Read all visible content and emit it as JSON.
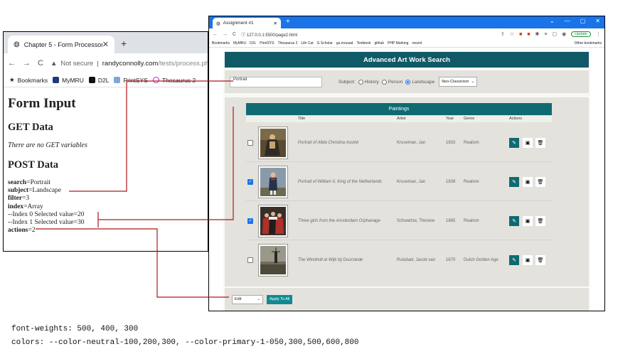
{
  "left_browser": {
    "tab_title": "Chapter 5 - Form Processor",
    "tab_close": "✕",
    "new_tab": "+",
    "address": {
      "not_secure": "Not secure",
      "separator": "|",
      "host": "randyconnolly.com",
      "path": "/tests/process.php"
    },
    "bookmarks": [
      "Bookmarks",
      "MyMRU",
      "D2L",
      "PrintSYS",
      "Thesaurus 2"
    ],
    "content": {
      "heading": "Form Input",
      "get_heading": "GET Data",
      "get_note": "There are no GET variables",
      "post_heading": "POST Data",
      "post_items": [
        {
          "key": "search",
          "value": "=Portrait"
        },
        {
          "key": "subject",
          "value": "=Landscape"
        },
        {
          "key": "filter",
          "value": "=3"
        },
        {
          "key": "index",
          "value": "=Array"
        },
        {
          "key": "",
          "value": "--Index 0 Selected value=20"
        },
        {
          "key": "",
          "value": "--Index 1 Selected value=30"
        },
        {
          "key": "actions",
          "value": "=2"
        }
      ]
    }
  },
  "right_browser": {
    "tab_title": "Assignment #1",
    "tab_close": "✕",
    "new_tab": "+",
    "window_controls": [
      "⌄",
      "—",
      "▢",
      "✕"
    ],
    "url": "127.0.0.1:5500/page2.html",
    "update_label": "Update",
    "bookmarks": [
      "Bookmarks",
      "MyMRU",
      "D2L",
      "PrintSYS",
      "Thesaurus 2",
      "Life Cat",
      "G Scholar",
      "gu.mrusad",
      "Textbook",
      "github",
      "PHP Marking",
      "recent"
    ],
    "other_bookmarks": "Other bookmarks"
  },
  "page": {
    "banner": "Advanced Art Work Search",
    "search_value": "Portrait",
    "subject_label": "Subject:",
    "subjects": [
      {
        "label": "History",
        "checked": false
      },
      {
        "label": "Person",
        "checked": false
      },
      {
        "label": "Landscape",
        "checked": true
      }
    ],
    "genre_selected": "Neo-Classicism",
    "paintings_heading": "Paintings",
    "columns": {
      "title": "Title",
      "artist": "Artist",
      "year": "Year",
      "genre": "Genre",
      "actions": "Actions"
    },
    "rows": [
      {
        "checked": false,
        "title": "Portrait of Alida Christina Assink",
        "artist": "Kruseman, Jan",
        "year": "1833",
        "genre": "Realism",
        "art": "art-1"
      },
      {
        "checked": true,
        "title": "Portrait of William II, King of the Netherlands",
        "artist": "Kruseman, Jan",
        "year": "1839",
        "genre": "Realism",
        "art": "art-2"
      },
      {
        "checked": true,
        "title": "Three girls from the Amsterdam Orphanage",
        "artist": "Schwartze, Therese",
        "year": "1885",
        "genre": "Realism",
        "art": "art-3"
      },
      {
        "checked": false,
        "title": "The Windmill at Wijk bij Duurstede",
        "artist": "Ruisdael, Jacob van",
        "year": "1670",
        "genre": "Dutch Golden Age",
        "art": "art-4"
      }
    ],
    "bulk_select": "Edit",
    "apply_label": "Apply To All"
  },
  "notes": {
    "weights": "font-weights: 500, 400, 300",
    "colors": "colors: --color-neutral-100,200,300, --color-primary-1-050,300,500,600,800"
  },
  "colors": {
    "connector": "#b0161c",
    "teal_dark": "#0f5a66",
    "teal": "#0f6a72",
    "chrome_blue": "#1a73e8"
  }
}
